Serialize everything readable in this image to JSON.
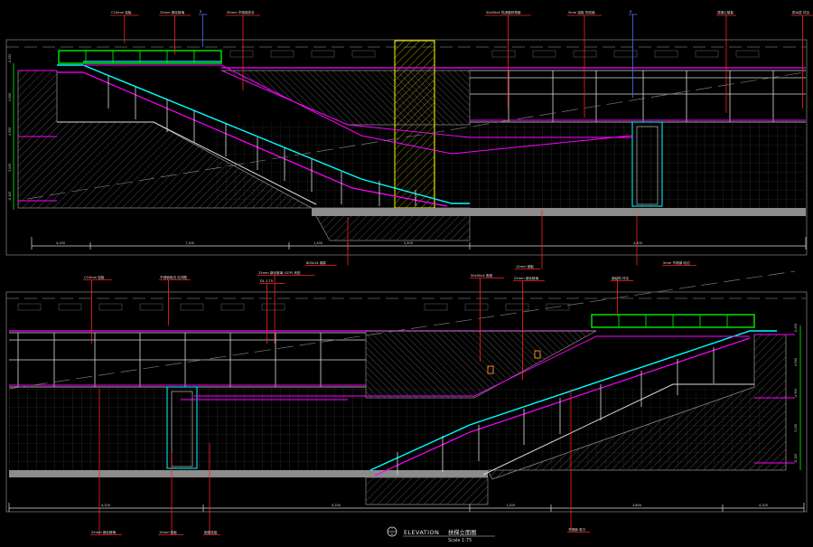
{
  "drawing": {
    "title": "ELEVATION",
    "subtitle": "扶梯立面图",
    "scale": "Scale 1:75",
    "detail_no": "2",
    "sheet_ref": "A"
  },
  "colors": {
    "background": "#000000",
    "magenta": "#ff00ff",
    "cyan": "#00ffff",
    "green": "#00ff00",
    "yellow": "#ffff00",
    "white": "#ffffff",
    "red": "#ff0000",
    "blue": "#2b57ff",
    "gray": "#8a8a8a",
    "orange": "#ff9b22"
  },
  "callouts_upper": [
    "C10mm 铝板",
    "25mm 钢化玻璃",
    "2",
    "50mm 不锈钢扶手",
    "50x50x4 热浸镀锌角钢",
    "5mm 铝板 完成面",
    "2",
    "混凝土楼板",
    "防水层 详见"
  ],
  "callouts_mid": [
    "800x14 钢梁",
    "12mm 钢板",
    "5mm 不锈钢 收边"
  ],
  "callouts_lower": [
    "C10mm 铝板",
    "不锈钢收边 见详图",
    "25mm 钢化玻璃 (SGP) 夹胶",
    "DL 1:75",
    "50x50x4 角钢",
    "25mm 钢化玻璃",
    "钢结构 详见"
  ],
  "callouts_bottom": [
    "25mm 钢化玻璃",
    "10mm 铝板",
    "固定连接",
    "不锈钢 收口"
  ],
  "dims_upper": [
    "4,200",
    "7,200",
    "1,200",
    "2,400",
    "4,200"
  ],
  "dims_lower": [
    "4,200",
    "4,200",
    "1,200",
    "3,600",
    "4,200"
  ],
  "levels_left": [
    "-0.450",
    "4,500",
    "-4.950",
    "3,150",
    "-8.100"
  ],
  "levels_right": [
    "-0.450",
    "4,500",
    "-4.950",
    "3,150",
    "-8.100"
  ]
}
